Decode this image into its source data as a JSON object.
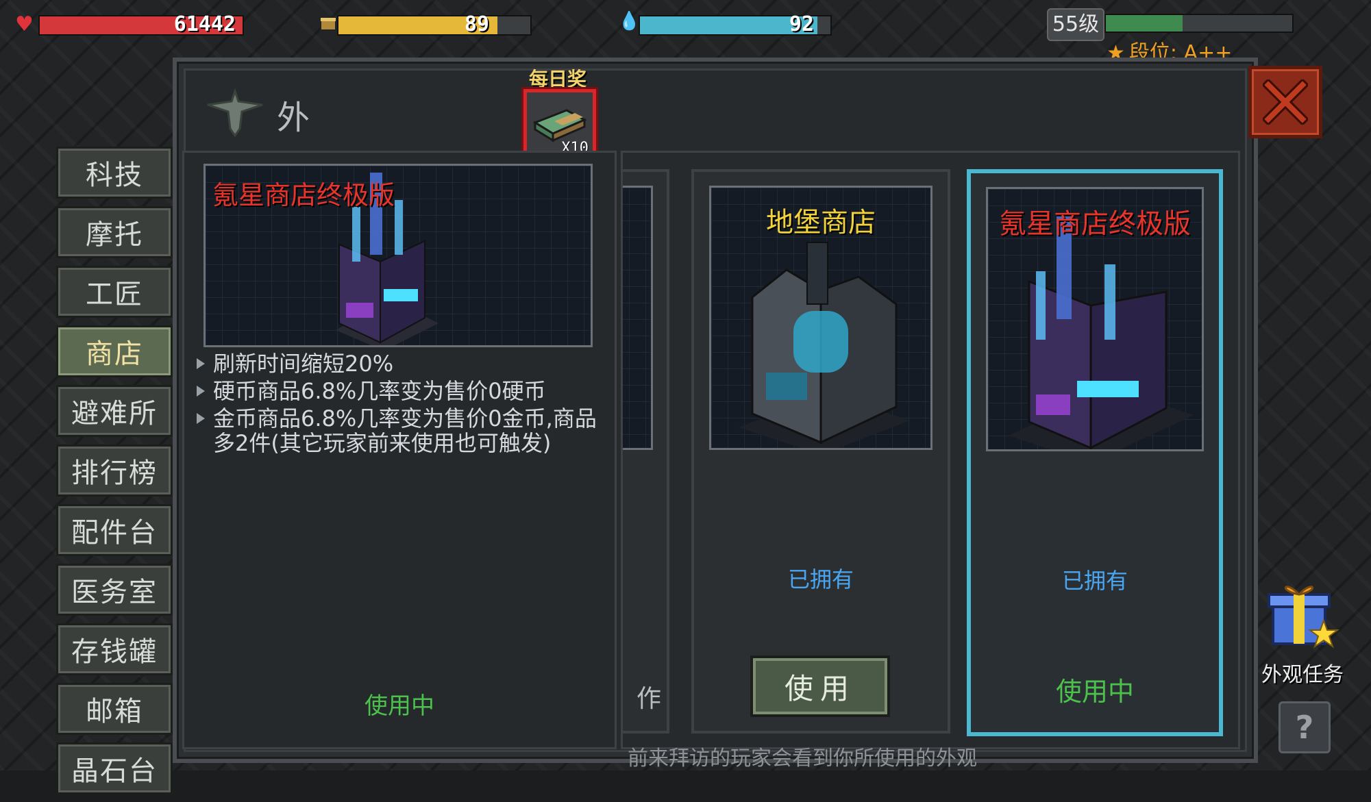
{
  "hud": {
    "hp": {
      "value": "61442",
      "fill": 1.0,
      "color": "#d4383a",
      "icon": "heart-icon"
    },
    "food": {
      "value": "89",
      "fill": 0.83,
      "color": "#e6b83a",
      "icon": "food-can-icon"
    },
    "water": {
      "value": "92",
      "fill": 0.93,
      "color": "#4bb6cc",
      "icon": "water-drops-icon"
    },
    "level": "55级",
    "level_progress": 0.41,
    "level_bar_color": "#3f8a4f",
    "rank_label": "段位: A++"
  },
  "window": {
    "title": "外观",
    "daily_reward": {
      "label": "每日奖",
      "count": "X10",
      "icon": "money-stack-icon"
    }
  },
  "tabs": [
    {
      "label": "科技",
      "active": false
    },
    {
      "label": "摩托",
      "active": false
    },
    {
      "label": "工匠",
      "active": false
    },
    {
      "label": "商店",
      "active": true
    },
    {
      "label": "避难所",
      "active": false
    },
    {
      "label": "排行榜",
      "active": false
    },
    {
      "label": "配件台",
      "active": false
    },
    {
      "label": "医务室",
      "active": false
    },
    {
      "label": "存钱罐",
      "active": false
    },
    {
      "label": "邮箱",
      "active": false
    },
    {
      "label": "晶石台",
      "active": false
    }
  ],
  "detail": {
    "name": "氪星商店终极版",
    "effects": [
      "刷新时间缩短20%",
      "硬币商品6.8%几率变为售价0硬币",
      "金币商品6.8%几率变为售价0金币,商品多2件(其它玩家前来使用也可触发)"
    ],
    "status": "使用中"
  },
  "cards": {
    "partial_text": "作",
    "bunker": {
      "title": "地堡商店",
      "title_color": "#f2d23a",
      "owned": "已拥有",
      "button": "使用"
    },
    "krypton": {
      "title": "氪星商店终极版",
      "title_color": "#e8342a",
      "owned": "已拥有",
      "status": "使用中"
    }
  },
  "footer_note": "前来拜访的玩家会看到你所使用的外观",
  "appearance_task": {
    "label": "外观任务",
    "icon": "gift-box-icon"
  },
  "help": "?"
}
